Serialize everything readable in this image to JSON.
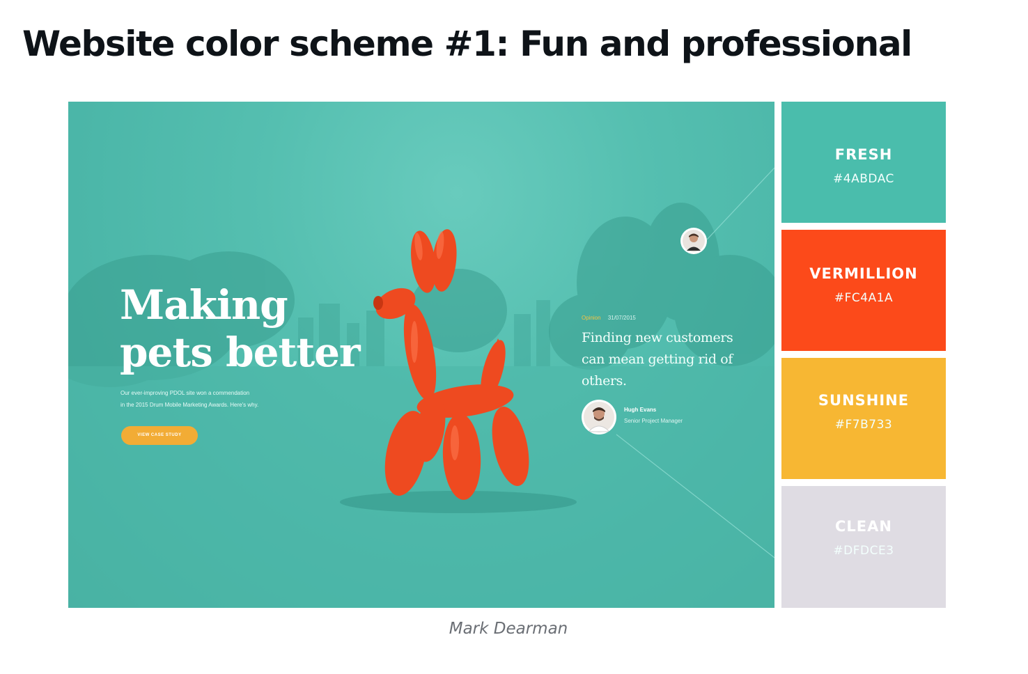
{
  "heading": "Website color scheme #1: Fun and professional",
  "hero": {
    "title": "Making pets better",
    "subtitle_line1": "Our ever-improving PDOL site won a commendation",
    "subtitle_line2": "in the 2015 Drum Mobile Marketing Awards. Here's why.",
    "button_label": "VIEW CASE STUDY",
    "quote_category": "Opinion",
    "quote_date": "31/07/2015",
    "quote_text": "Finding new customers can mean getting rid of others.",
    "author_name": "Hugh Evans",
    "author_role": "Senior Project Manager"
  },
  "palette": [
    {
      "name": "FRESH",
      "hex_label": "#4ABDAC",
      "color": "#4ABDAC"
    },
    {
      "name": "VERMILLION",
      "hex_label": "#FC4A1A",
      "color": "#FC4A1A"
    },
    {
      "name": "SUNSHINE",
      "hex_label": "#F7B733",
      "color": "#F7B733"
    },
    {
      "name": "CLEAN",
      "hex_label": "#DFDCE3",
      "color": "#DFDCE3"
    }
  ],
  "caption": "Mark Dearman",
  "icons": {
    "balloon_dog": "balloon-dog-illustration",
    "author_avatar": "person-avatar-icon",
    "top_avatar": "person-avatar-icon"
  }
}
